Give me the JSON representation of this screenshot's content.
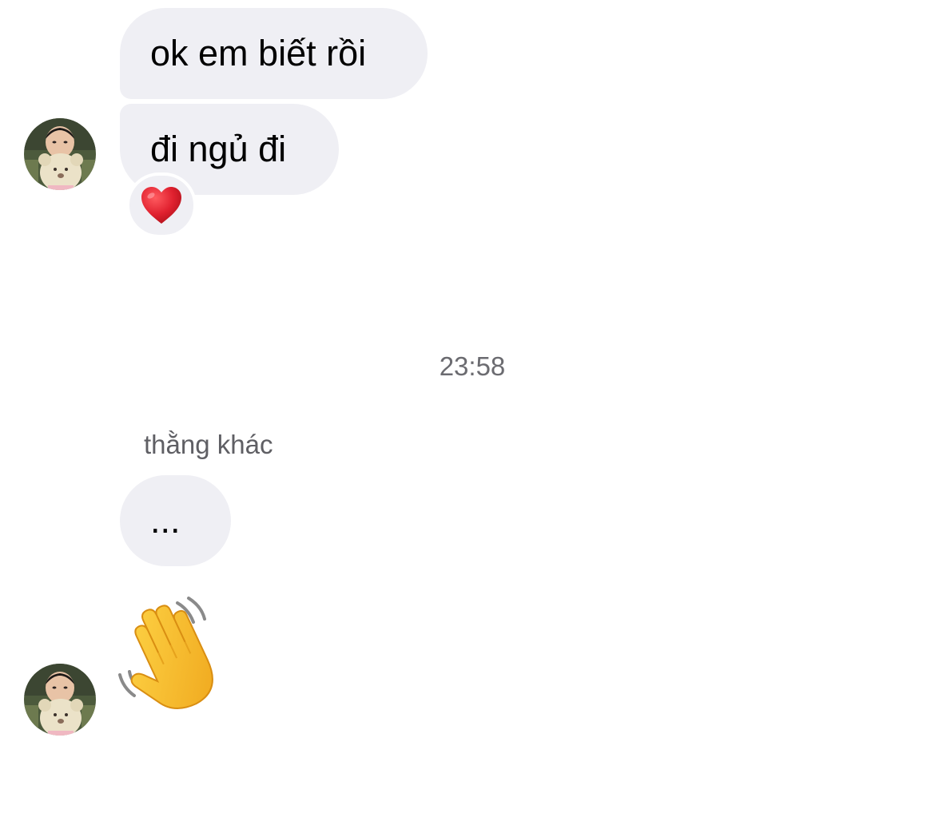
{
  "messages": [
    {
      "text": "ok em biết rồi"
    },
    {
      "text": "đi ngủ đi",
      "reaction": "heart"
    },
    {
      "text": "..."
    }
  ],
  "timestamp": "23:58",
  "reply_label": "thằng khác",
  "icons": {
    "reaction": "red-heart-icon",
    "sticker": "waving-hand-icon",
    "avatar": "contact-avatar"
  },
  "colors": {
    "bubble": "#efeff4",
    "heart": "#e0212f",
    "hand": "#f7c62e",
    "meta_text": "#6b6b70"
  }
}
